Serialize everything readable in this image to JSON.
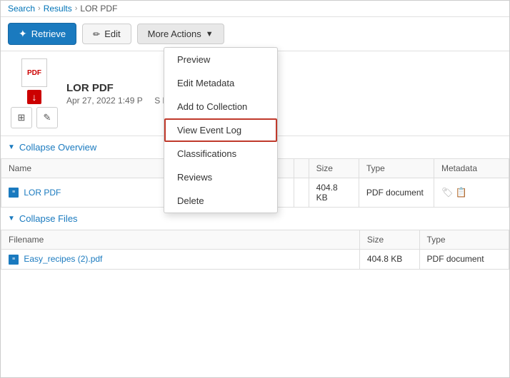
{
  "breadcrumb": {
    "items": [
      "Search",
      "Results",
      "LOR PDF"
    ],
    "separators": [
      "›",
      "›"
    ]
  },
  "toolbar": {
    "retrieve_label": "Retrieve",
    "edit_label": "Edit",
    "more_actions_label": "More Actions"
  },
  "document": {
    "title": "LOR PDF",
    "meta": "Apr 27, 2022 1:49 P",
    "badge": "S LOR",
    "pdf_label": "PDF"
  },
  "dropdown_menu": {
    "items": [
      {
        "label": "Preview",
        "active": false
      },
      {
        "label": "Edit Metadata",
        "active": false
      },
      {
        "label": "Add to Collection",
        "active": false
      },
      {
        "label": "View Event Log",
        "active": true
      },
      {
        "label": "Classifications",
        "active": false
      },
      {
        "label": "Reviews",
        "active": false
      },
      {
        "label": "Delete",
        "active": false
      }
    ]
  },
  "overview_section": {
    "label": "Collapse Overview"
  },
  "overview_table": {
    "columns": [
      "Name",
      "",
      "Size",
      "Type",
      "Metadata"
    ],
    "rows": [
      {
        "name": "LOR PDF",
        "size": "404.8 KB",
        "type": "PDF document"
      }
    ]
  },
  "files_section": {
    "label": "Collapse Files"
  },
  "files_table": {
    "columns": [
      "Filename",
      "Size",
      "Type"
    ],
    "rows": [
      {
        "filename": "Easy_recipes (2).pdf",
        "size": "404.8 KB",
        "type": "PDF document"
      }
    ]
  }
}
